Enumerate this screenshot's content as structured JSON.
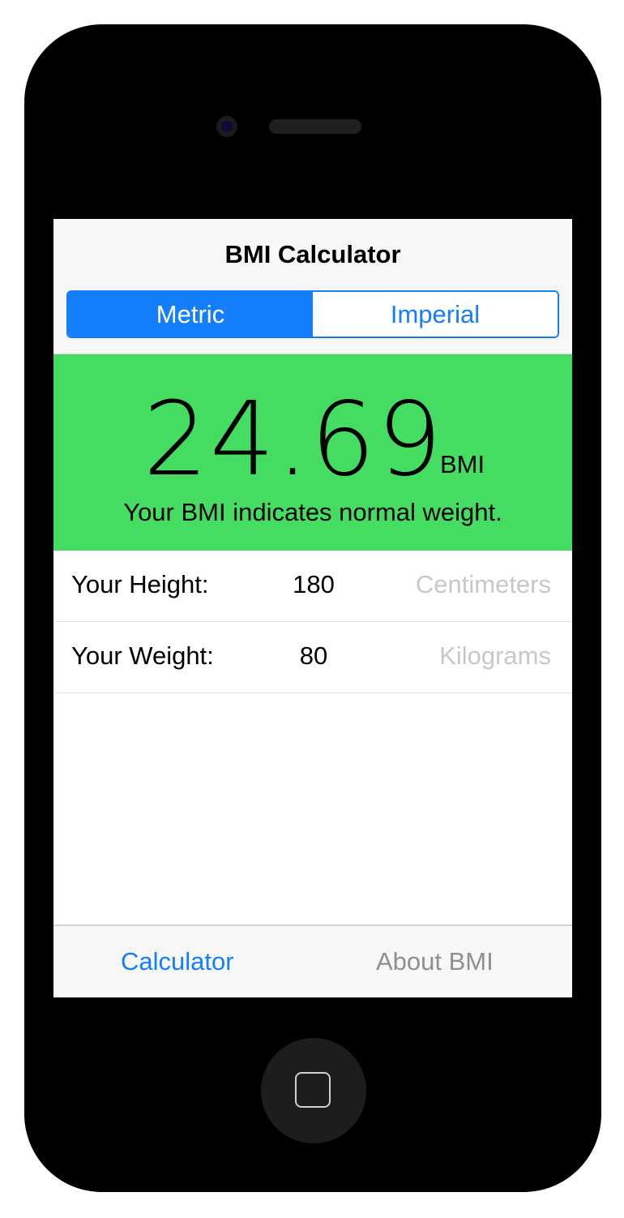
{
  "navbar": {
    "title": "BMI Calculator",
    "segments": [
      "Metric",
      "Imperial"
    ],
    "selected_segment": "Metric"
  },
  "result": {
    "bmi_value": "24.69",
    "bmi_unit": "BMI",
    "message": "Your BMI indicates normal weight.",
    "background_color": "#44dd62"
  },
  "rows": {
    "height": {
      "label": "Your Height:",
      "value": "180",
      "unit": "Centimeters"
    },
    "weight": {
      "label": "Your Weight:",
      "value": "80",
      "unit": "Kilograms"
    }
  },
  "tabbar": {
    "tabs": [
      "Calculator",
      "About BMI"
    ],
    "active_tab": "Calculator"
  },
  "colors": {
    "accent": "#157efb",
    "placeholder_gray": "#c7c7cc",
    "inactive_tab_gray": "#8e8e93"
  },
  "icons": {
    "front_camera": "camera-icon",
    "speaker": "speaker-grille-icon",
    "home_button": "home-square-icon"
  }
}
